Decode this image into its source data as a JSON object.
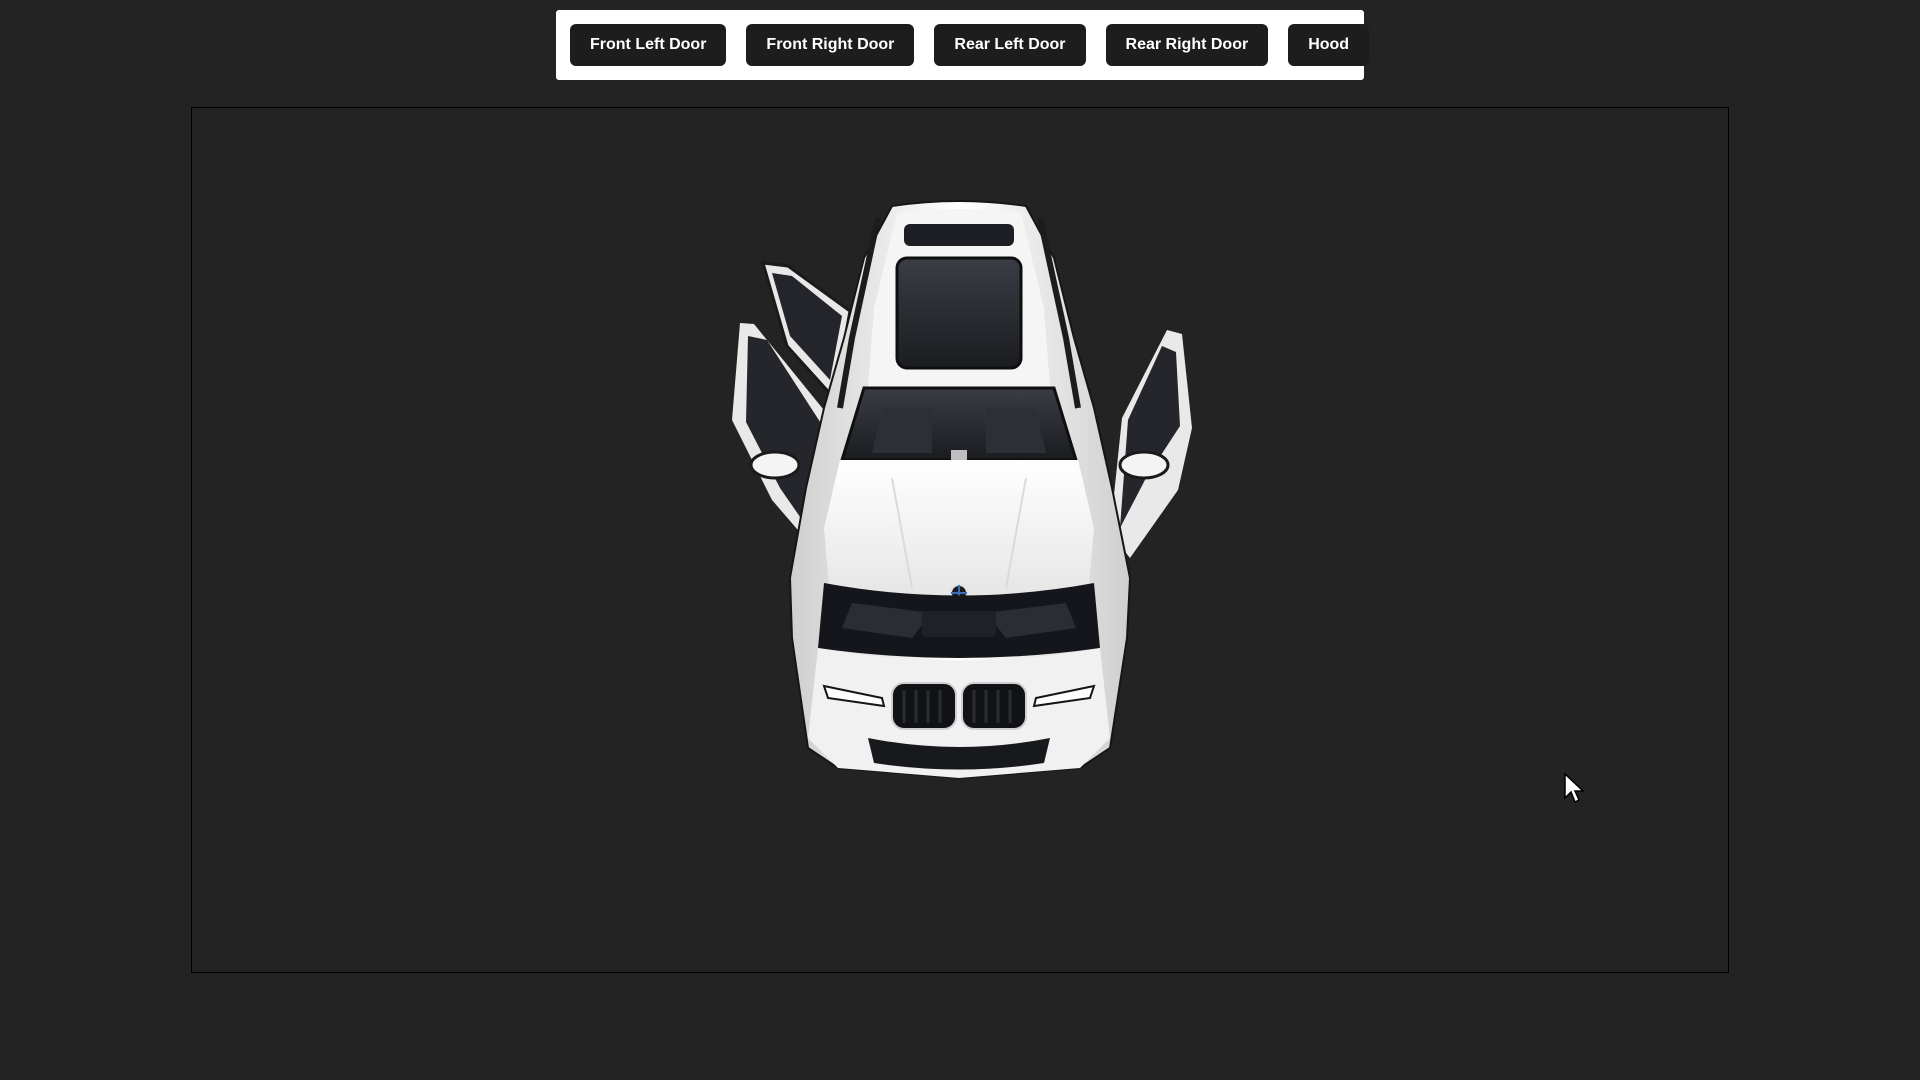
{
  "toolbar": {
    "buttons": [
      {
        "label": "Front Left Door"
      },
      {
        "label": "Front Right Door"
      },
      {
        "label": "Rear Left Door"
      },
      {
        "label": "Rear Right Door"
      },
      {
        "label": "Hood"
      }
    ]
  },
  "viewer": {
    "background_color": "#232323",
    "car_color": "#f2f2f2",
    "icon": "car-model"
  },
  "colors": {
    "page_background": "#232323",
    "toolbar_background": "#ffffff",
    "button_background": "#1d1d1d",
    "button_text": "#ffffff"
  }
}
